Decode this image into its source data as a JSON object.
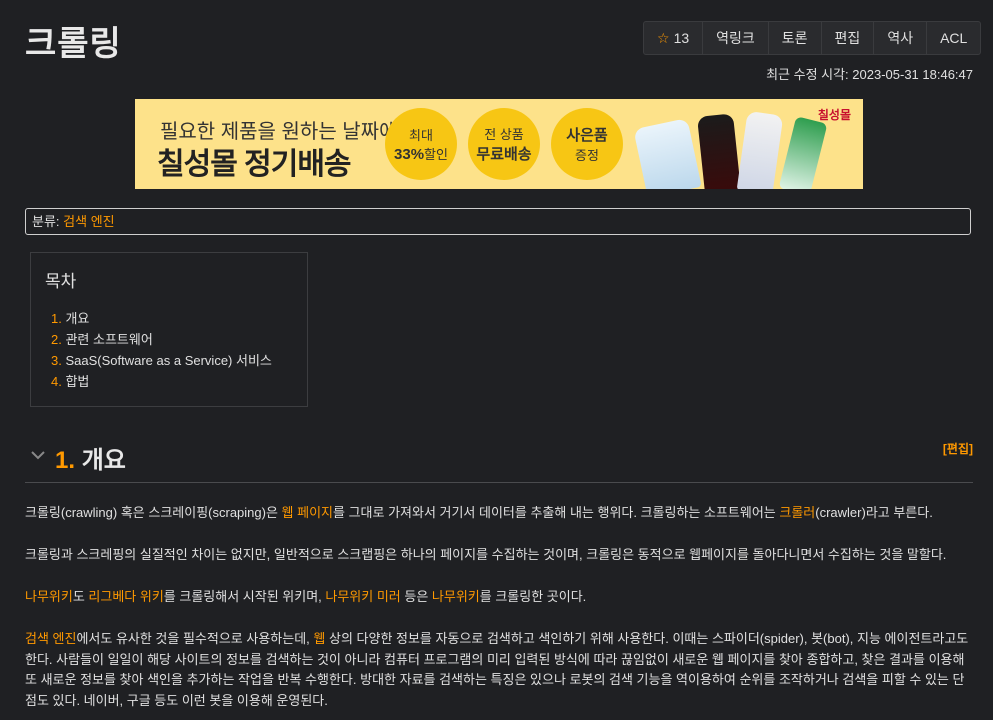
{
  "page": {
    "title": "크롤링"
  },
  "toolbar": {
    "star_count": "13",
    "backlinks": "역링크",
    "discuss": "토론",
    "edit": "편집",
    "history": "역사",
    "acl": "ACL"
  },
  "last_modified": "최근 수정 시각: 2023-05-31 18:46:47",
  "ad": {
    "line1": "필요한 제품을 원하는 날짜에",
    "line2": "칠성몰 정기배송",
    "c1_small": "최대",
    "c1_big": "33%",
    "c1_suffix": "할인",
    "c2_small": "전 상품",
    "c2_big": "무료배송",
    "c3_big": "사은품",
    "c3_small": "증정",
    "brand": "칠성몰"
  },
  "category": {
    "label": "분류:",
    "link": "검색 엔진"
  },
  "toc": {
    "title": "목차",
    "items": [
      {
        "num": "1.",
        "label": "개요"
      },
      {
        "num": "2.",
        "label": "관련 소프트웨어"
      },
      {
        "num": "3.",
        "label": "SaaS(Software as a Service) 서비스"
      },
      {
        "num": "4.",
        "label": "합법"
      }
    ]
  },
  "section": {
    "num": "1.",
    "title": "개요",
    "edit": "[편집]"
  },
  "paragraphs": {
    "p1": {
      "a": "크롤링(crawling) 혹은 스크레이핑(scraping)은 ",
      "link1": "웹 페이지",
      "b": "를 그대로 가져와서 거기서 데이터를 추출해 내는 행위다. 크롤링하는 소프트웨어는 ",
      "link2": "크롤러",
      "c": "(crawler)라고 부른다."
    },
    "p2": "크롤링과 스크레핑의 실질적인 차이는 없지만, 일반적으로 스크랩핑은 하나의 페이지를 수집하는 것이며, 크롤링은 동적으로 웹페이지를 돌아다니면서 수집하는 것을 말할다.",
    "p3": {
      "link1": "나무위키",
      "a": "도 ",
      "link2": "리그베다 위키",
      "b": "를 크롤링해서 시작된 위키며, ",
      "link3": "나무위키 미러",
      "c": " 등은 ",
      "link4": "나무위키",
      "d": "를 크롤링한 곳이다."
    },
    "p4": {
      "link1": "검색 엔진",
      "a": "에서도 유사한 것을 필수적으로 사용하는데, ",
      "link2": "웹",
      "b": " 상의 다양한 정보를 자동으로 검색하고 색인하기 위해 사용한다. 이때는 스파이더(spider), 봇(bot), 지능 에이전트라고도 한다. 사람들이 일일이 해당 사이트의 정보를 검색하는 것이 아니라 컴퓨터 프로그램의 미리 입력된 방식에 따라 끊임없이 새로운 웹 페이지를 찾아 종합하고, 찾은 결과를 이용해 또 새로운 정보를 찾아 색인을 추가하는 작업을 반복 수행한다. 방대한 자료를 검색하는 특징은 있으나 로봇의 검색 기능을 역이용하여 순위를 조작하거나 검색을 피할 수 있는 단점도 있다. 네이버, 구글 등도 이런 봇을 이용해 운영된다."
    }
  }
}
